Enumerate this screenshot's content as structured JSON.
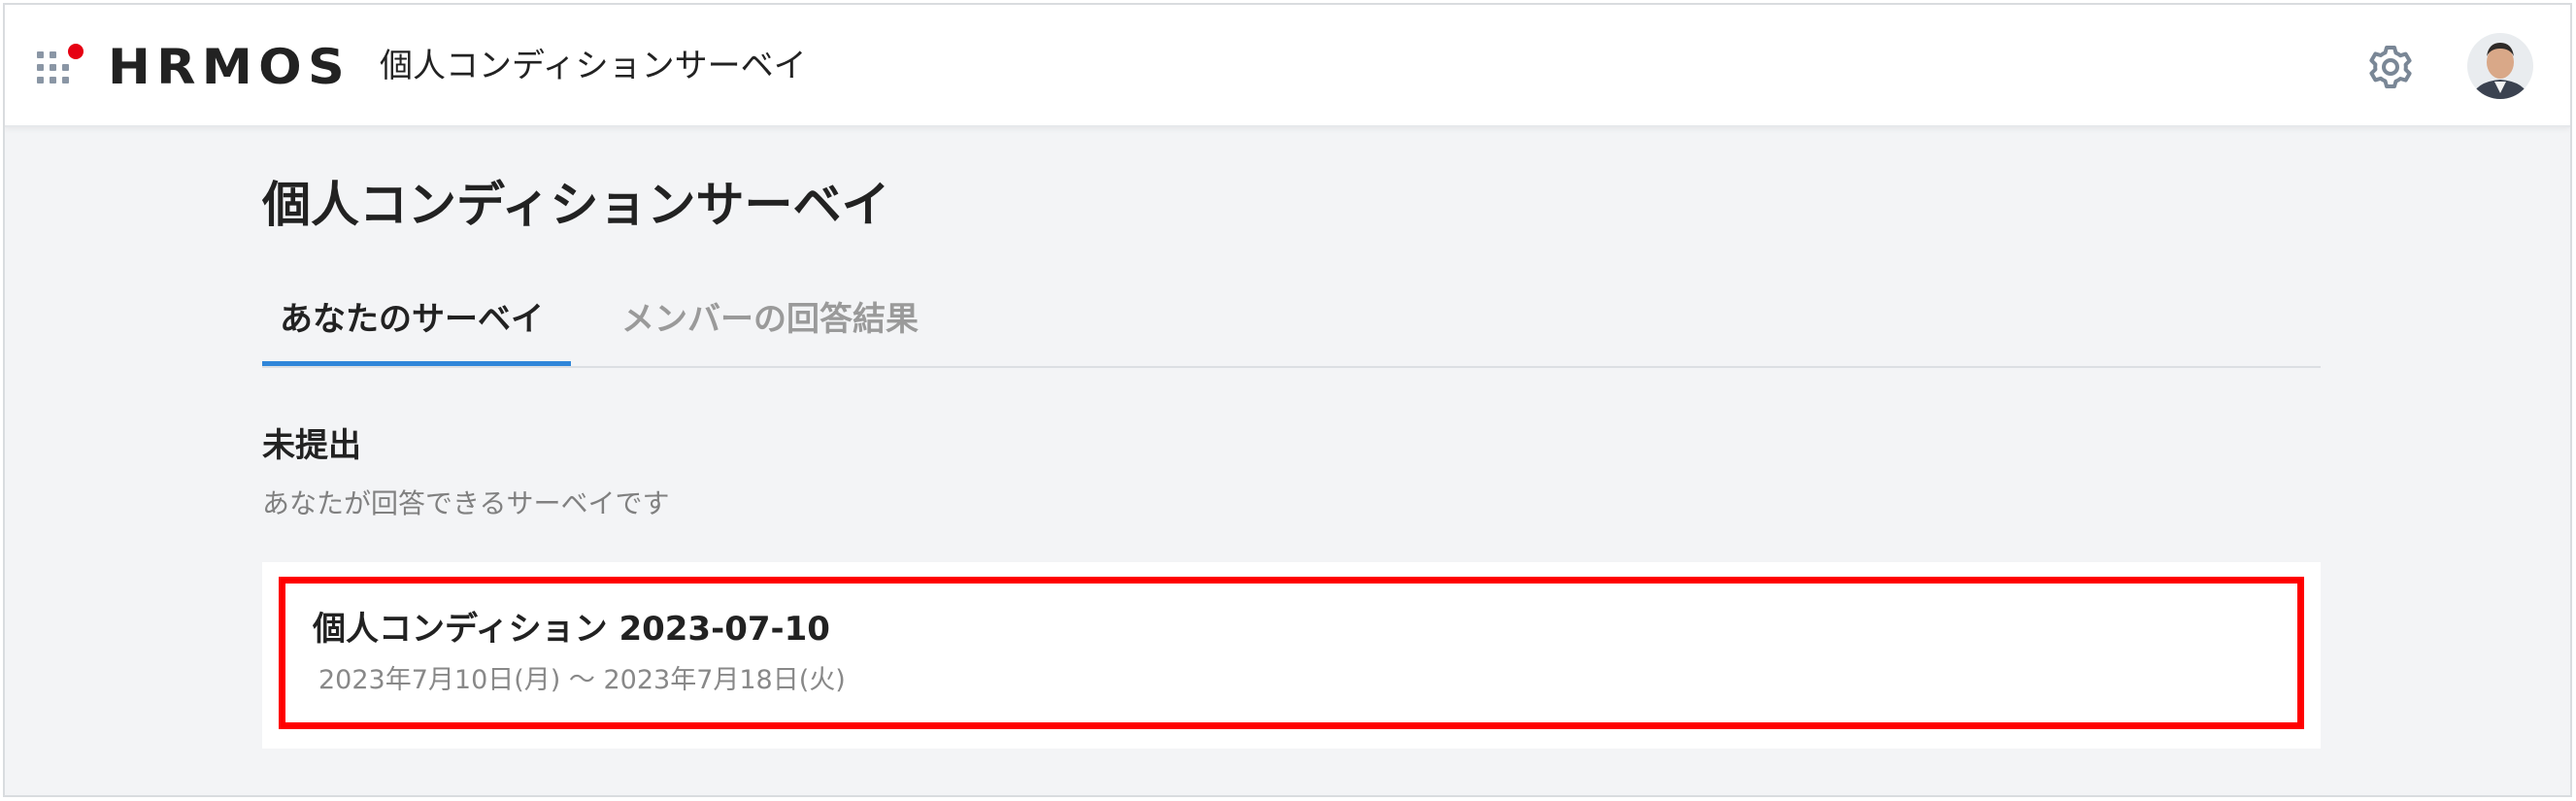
{
  "header": {
    "logo_text": "HRMOS",
    "app_title": "個人コンディションサーベイ",
    "brand_dot_color": "#e60012",
    "icons": {
      "apps": "apps-grid-icon",
      "settings": "gear-icon",
      "avatar": "user-avatar"
    }
  },
  "main": {
    "page_title": "個人コンディションサーベイ",
    "tabs": [
      {
        "label": "あなたのサーベイ",
        "active": true
      },
      {
        "label": "メンバーの回答結果",
        "active": false
      }
    ],
    "section": {
      "title": "未提出",
      "description": "あなたが回答できるサーベイです"
    },
    "surveys": [
      {
        "name": "個人コンディション 2023-07-10",
        "period": "2023年7月10日(月) 〜 2023年7月18日(火)"
      }
    ]
  },
  "colors": {
    "accent": "#2f86d9",
    "highlight": "#ff0000",
    "background": "#f3f4f6"
  }
}
